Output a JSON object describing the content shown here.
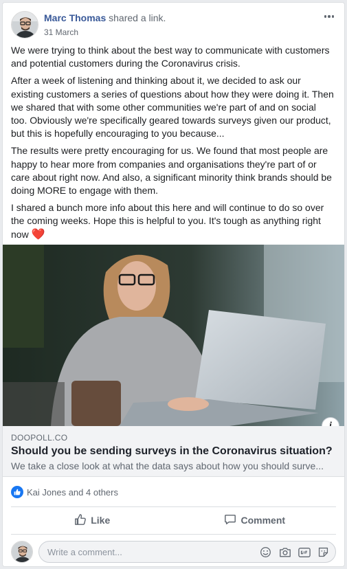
{
  "post": {
    "author": "Marc Thomas",
    "action": " shared a link.",
    "date": "31 March",
    "paragraphs": [
      "We were trying to think about the best way to communicate with customers and potential customers during the Coronavirus crisis.",
      "After a week of listening and thinking about it, we decided to ask our existing customers a series of questions about how they were doing it. Then we shared that with some other communities we're part of and on social too. Obviously we're specifically geared towards surveys given our product, but this is hopefully encouraging to you because...",
      "The results were pretty encouraging for us. We found that most people are happy to hear more from companies and organisations they're part of or care about right now. And also, a significant minority think brands should be doing MORE to engage with them.",
      "I shared a bunch more info about this here and will continue to do so over the coming weeks. Hope this is helpful to you. It's tough as anything right now"
    ],
    "emoji": "❤️"
  },
  "link": {
    "domain": "DOOPOLL.CO",
    "title": "Should you be sending surveys in the Coronavirus situation?",
    "description": "We take a close look at what the data says about how you should surve...",
    "info_label": "i"
  },
  "reactions": {
    "text": "Kai Jones and 4 others"
  },
  "actions": {
    "like": "Like",
    "comment": "Comment"
  },
  "comment_box": {
    "placeholder": "Write a comment..."
  },
  "colors": {
    "author_link": "#385898",
    "like_blue": "#1877f2",
    "secondary_text": "#606770",
    "link_preview_bg": "#f2f3f5"
  },
  "icons": [
    "more-icon",
    "info-icon",
    "like-reaction-icon",
    "thumbs-up-icon",
    "comment-icon",
    "emoji-icon",
    "camera-icon",
    "gif-icon",
    "sticker-icon"
  ]
}
